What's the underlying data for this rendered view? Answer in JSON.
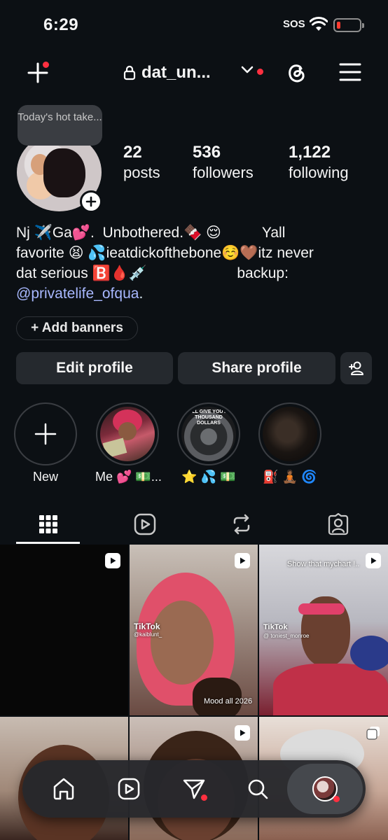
{
  "status_bar": {
    "time": "6:29",
    "carrier": "SOS"
  },
  "header": {
    "username": "dat_un..."
  },
  "note": {
    "text": "Today's hot take..."
  },
  "stats": [
    {
      "value": "22",
      "label": "posts"
    },
    {
      "value": "536",
      "label": "followers"
    },
    {
      "value": "1,122",
      "label": "following"
    }
  ],
  "bio": {
    "text": "Nj ✈️Ga💕.  Unbothered.🍫 😌          Yall\nfavorite 😫 💦ieatdickofthebone☺️🤎itz never\ndat serious 🅱️🩸💉                      backup:",
    "link": "@privatelife_ofqua",
    "link_suffix": "."
  },
  "add_banners": "+ Add banners",
  "buttons": {
    "edit": "Edit profile",
    "share": "Share profile"
  },
  "highlights": [
    {
      "label": "New"
    },
    {
      "label": "Me 💕 💵..."
    },
    {
      "label": "⭐ 💦 💵"
    },
    {
      "label": "⛽ 🧘🏾 🌀"
    }
  ],
  "highlight_thumb_text": "I'LL GIVE YOU A THOUSAND DOLLARS",
  "grid": {
    "captions": [
      {
        "text": ""
      },
      {
        "text": "Mood all 2026",
        "watermark": "TikTok",
        "handle": "@kaiblunt_"
      },
      {
        "text": "Show that mychart !..",
        "watermark": "TikTok",
        "handle": "@ toniest_monroe"
      }
    ]
  },
  "colors": {
    "background": "#0c1014",
    "accent_red": "#ff3040",
    "link": "#a8b8ff",
    "button": "#25292e"
  }
}
